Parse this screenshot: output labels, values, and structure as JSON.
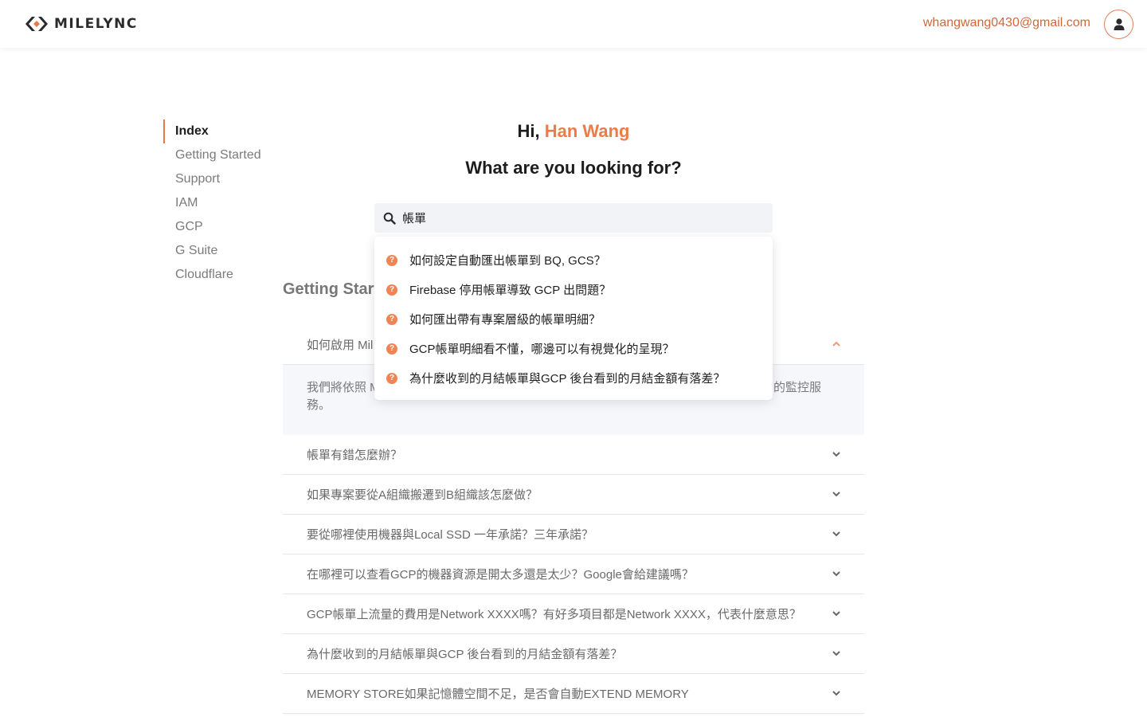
{
  "header": {
    "logo_text": "MILELYNC",
    "user_email": "whangwang0430@gmail.com"
  },
  "sidebar": {
    "items": [
      {
        "label": "Index"
      },
      {
        "label": "Getting Started"
      },
      {
        "label": "Support"
      },
      {
        "label": "IAM"
      },
      {
        "label": "GCP"
      },
      {
        "label": "G Suite"
      },
      {
        "label": "Cloudflare"
      }
    ]
  },
  "hero": {
    "greeting": "Hi, ",
    "user_name": "Han Wang",
    "question": "What are you looking for?"
  },
  "search": {
    "value": "帳單"
  },
  "suggestions": [
    {
      "label": "如何設定自動匯出帳單到 BQ, GCS？"
    },
    {
      "label": "Firebase 停用帳單導致 GCP 出問題？"
    },
    {
      "label": "如何匯出帶有專案層級的帳單明細？"
    },
    {
      "label": "GCP帳單明細看不懂，哪邊可以有視覺化的呈現？"
    },
    {
      "label": "為什麼收到的月結帳單與GCP 後台看到的月結金額有落差？"
    }
  ],
  "section": {
    "title_visible": "Getting Start"
  },
  "faq": {
    "open_item": {
      "question_visible": "如何啟用 Mil",
      "answer_start": "我們將依照 M",
      "answer_end_line1": "的監控服",
      "answer_line2": "務。"
    },
    "items": [
      {
        "question": "帳單有錯怎麼辦？"
      },
      {
        "question": "如果專案要從A組織搬遷到B組織該怎麼做？"
      },
      {
        "question": "要從哪裡使用機器與Local SSD 一年承諾？三年承諾？"
      },
      {
        "question": "在哪裡可以查看GCP的機器資源是開太多還是太少？Google會給建議嗎？"
      },
      {
        "question": "GCP帳單上流量的費用是Network XXXX嗎？有好多項目都是Network XXXX，代表什麼意思？"
      },
      {
        "question": "為什麼收到的月結帳單與GCP 後台看到的月結金額有落差？"
      },
      {
        "question": "MEMORY STORE如果記憶體空間不足，是否會自動EXTEND MEMORY"
      }
    ]
  },
  "colors": {
    "accent": "#ee7a48",
    "email": "#d0683a",
    "search_bg": "#f1f3f6"
  }
}
